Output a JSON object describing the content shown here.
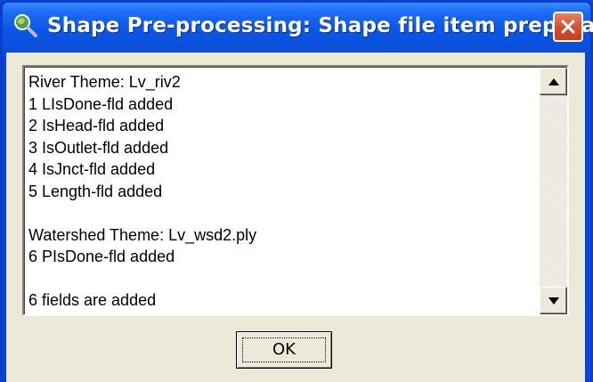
{
  "window": {
    "title": "Shape Pre-processing: Shape file item prepara...",
    "icon": "magnifier-globe-icon",
    "close_icon": "close-x-icon"
  },
  "log": {
    "lines": [
      "River Theme: Lv_riv2",
      "1 LIsDone-fld added",
      "2 IsHead-fld added",
      "3 IsOutlet-fld added",
      "4 IsJnct-fld added",
      "5 Length-fld added",
      "",
      "Watershed Theme: Lv_wsd2.ply",
      "6 PIsDone-fld added",
      "",
      "6 fields are added"
    ]
  },
  "buttons": {
    "ok_label": "OK"
  },
  "colors": {
    "titlebar": "#0a56e6",
    "close_button": "#d5502f",
    "dialog_bg": "#ece9d8"
  }
}
